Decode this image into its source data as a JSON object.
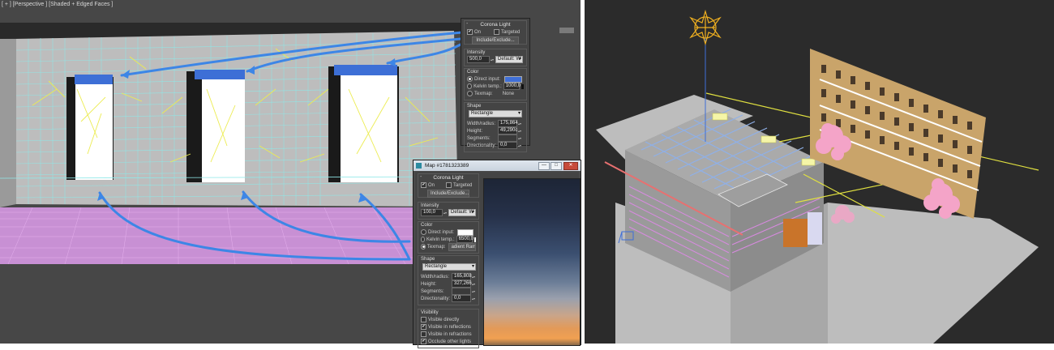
{
  "viewport_left": {
    "label": "[ + ] [Perspective ] [Shaded + Edged Faces ]"
  },
  "corona_panel_top": {
    "title": "Corona Light",
    "on_label": "On",
    "targeted_label": "Targeted",
    "include_exclude": "Include/Exclude...",
    "intensity": {
      "group": "Intensity",
      "value": "500,0",
      "unit": "Default: W"
    },
    "color": {
      "group": "Color",
      "direct_input": "Direct input:",
      "kelvin": "Kelvin temp.:",
      "kelvin_value": "1000,0",
      "texmap": "Texmap:",
      "texmap_value": "None"
    },
    "shape": {
      "group": "Shape",
      "type": "Rectangle",
      "width_label": "Width/radius:",
      "width_value": "175,864",
      "height_label": "Height:",
      "height_value": "49,290c",
      "segments_label": "Segments:",
      "directionality_label": "Directionality:",
      "directionality_value": "0,0"
    },
    "colors": {
      "direct_swatch": "#3f6fd8"
    }
  },
  "map_window": {
    "title": "Map #1781323389",
    "buttons": {
      "min": "—",
      "max": "□",
      "close": "✕"
    },
    "corona": {
      "title": "Corona Light",
      "on_label": "On",
      "targeted_label": "Targeted",
      "include_exclude": "Include/Exclude...",
      "intensity": {
        "group": "Intensity",
        "value": "100,0",
        "unit": "Default: W"
      },
      "color": {
        "group": "Color",
        "direct_input": "Direct input:",
        "kelvin": "Kelvin temp.:",
        "kelvin_value": "6500,0",
        "texmap": "Texmap:",
        "texmap_value": "adient Ramp"
      },
      "shape": {
        "group": "Shape",
        "type": "Rectangle",
        "width_label": "Width/radius:",
        "width_value": "165,808",
        "height_label": "Height:",
        "height_value": "327,266",
        "segments_label": "Segments:",
        "directionality_label": "Directionality:",
        "directionality_value": "0,0"
      },
      "visibility": {
        "group": "Visibility",
        "items": [
          {
            "label": "Visible directly",
            "checked": false
          },
          {
            "label": "Visible in reflections",
            "checked": true
          },
          {
            "label": "Visible in refractions",
            "checked": false
          },
          {
            "label": "Occlude other lights",
            "checked": true
          }
        ]
      }
    }
  },
  "colors": {
    "arrow": "#3d86e6",
    "window_blue": "#3d6fd6",
    "grid_cyan": "#8fe8e8",
    "floor_pink": "#d88ae0",
    "yellow_rays": "#ecec50"
  }
}
